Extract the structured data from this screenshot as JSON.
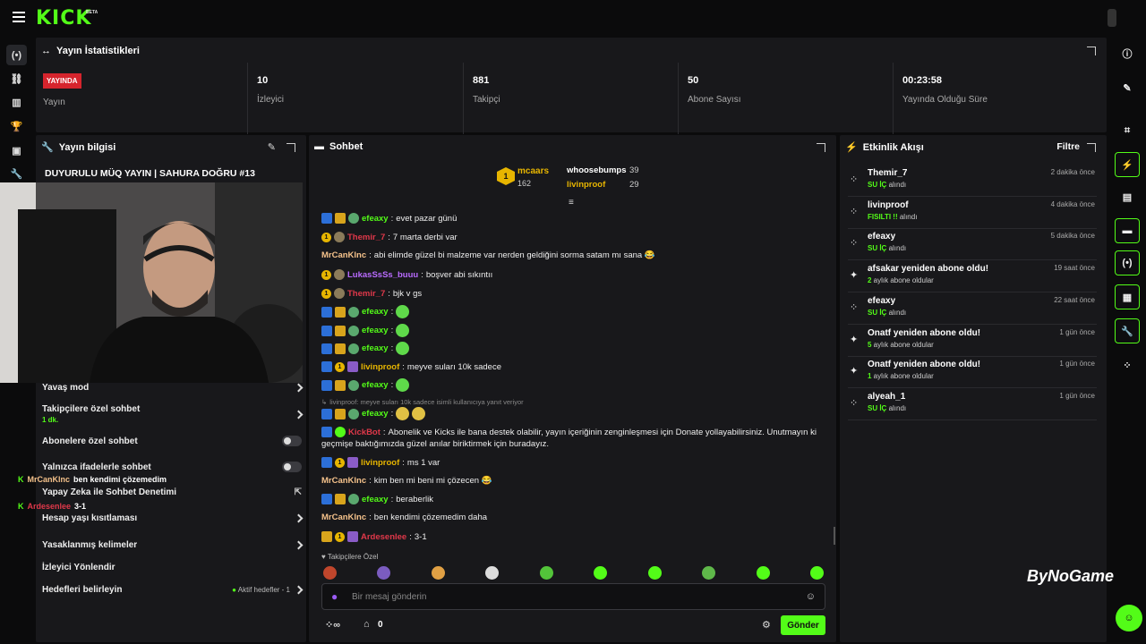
{
  "brand": {
    "logo": "KICK",
    "beta": "BETA",
    "color": "#53fc18"
  },
  "stats": {
    "title": "Yayın İstatistikleri",
    "live_badge": "YAYINDA",
    "items": [
      {
        "value": "",
        "label": "Yayın"
      },
      {
        "value": "10",
        "label": "İzleyici"
      },
      {
        "value": "881",
        "label": "Takipçi"
      },
      {
        "value": "50",
        "label": "Abone Sayısı"
      },
      {
        "value": "00:23:58",
        "label": "Yayında Olduğu Süre"
      }
    ]
  },
  "stream_info": {
    "title": "Yayın bilgisi",
    "stream_title": "DUYURULU MÜQ YAYIN | SAHURA DOĞRU #13",
    "settings": [
      {
        "label": "Yavaş mod",
        "control": "chevron"
      },
      {
        "label": "Takipçilere özel sohbet",
        "sub": "1 dk.",
        "control": "chevron"
      },
      {
        "label": "Abonelere özel sohbet",
        "control": "toggle"
      },
      {
        "label": "Yalnızca ifadelerle sohbet",
        "control": "toggle"
      },
      {
        "label": "Yapay Zeka ile Sohbet Denetimi",
        "control": "external"
      },
      {
        "label": "Hesap yaşı kısıtlaması",
        "control": "chevron"
      },
      {
        "label": "Yasaklanmış kelimeler",
        "control": "chevron"
      },
      {
        "label": "İzleyici Yönlendir",
        "control": "none"
      },
      {
        "label": "Hedefleri belirleyin",
        "extra": "Aktif hedefler - 1",
        "control": "chevron"
      }
    ],
    "overlay_chat": [
      {
        "user": "MrCanKlnc",
        "text": "ben kendimi çözemedim"
      },
      {
        "user": "Ardesenlee",
        "text": "3-1"
      }
    ]
  },
  "chat": {
    "title": "Sohbet",
    "leaderboard": {
      "top_name": "mcaars",
      "top_count": "162",
      "rank": "1",
      "second_name": "whoosebumps",
      "second_count": "39",
      "third_name": "livinproof",
      "third_count": "29"
    },
    "messages": [
      {
        "user": "efeaxy",
        "color": "#53fc18",
        "text": "evet pazar günü"
      },
      {
        "user": "Themir_7",
        "color": "#e0384a",
        "text": "7 marta derbi var"
      },
      {
        "user": "MrCanKlnc",
        "color": "#f5c28b",
        "text": "abi elimde güzel bi malzeme var nerden geldiğini sorma satam mı sana 😂"
      },
      {
        "user": "LukasSsSs_buuu",
        "color": "#b96bff",
        "text": "boşver abi sıkıntıı"
      },
      {
        "user": "Themir_7",
        "color": "#e0384a",
        "text": "bjk v gs"
      },
      {
        "user": "efeaxy",
        "color": "#53fc18",
        "text": ""
      },
      {
        "user": "efeaxy",
        "color": "#53fc18",
        "text": ""
      },
      {
        "user": "efeaxy",
        "color": "#53fc18",
        "text": ""
      },
      {
        "user": "livinproof",
        "color": "#e7b500",
        "text": "meyve suları 10k sadece"
      },
      {
        "user": "efeaxy",
        "color": "#53fc18",
        "text": ""
      },
      {
        "user": "efeaxy",
        "color": "#53fc18",
        "text": ""
      },
      {
        "user": "KickBot",
        "color": "#e0384a",
        "text": "Abonelik ve Kicks ile bana destek olabilir, yayın içeriğinin zenginleşmesi için Donate yollayabilirsiniz. Unutmayın ki"
      },
      {
        "user": "livinproof",
        "color": "#e7b500",
        "text": "ms 1 var"
      },
      {
        "user": "MrCanKlnc",
        "color": "#f5c28b",
        "text": "kim ben mi beni mi çözecen 😂"
      },
      {
        "user": "efeaxy",
        "color": "#53fc18",
        "text": "beraberlik"
      },
      {
        "user": "MrCanKlnc",
        "color": "#f5c28b",
        "text": "ben kendimi çözemedim daha"
      },
      {
        "user": "Ardesenlee",
        "color": "#e0384a",
        "text": "3-1"
      }
    ],
    "kickbot_line2": "geçmişe baktığımızda güzel anılar biriktirmek için buradayız.",
    "reply_note": "livinproof: meyve suları 10k sadece isimli kullanıcıya yanıt veriyor",
    "followers_only": "Takipçilere Özel",
    "input_placeholder": "Bir mesaj gönderin",
    "send": "Gönder",
    "kicks_count": "0"
  },
  "activity": {
    "title": "Etkinlik Akışı",
    "filter": "Filtre",
    "events": [
      {
        "name": "Themir_7",
        "hl": "SU İÇ",
        "rest": " alındı",
        "time": "2 dakika önce",
        "icon": "gift"
      },
      {
        "name": "livinproof",
        "hl": "FISILTI !!",
        "rest": " alındı",
        "time": "4 dakika önce",
        "icon": "gift"
      },
      {
        "name": "efeaxy",
        "hl": "SU İÇ",
        "rest": " alındı",
        "time": "5 dakika önce",
        "icon": "gift"
      },
      {
        "name": "afsakar yeniden abone oldu!",
        "hl": "2",
        "rest": " aylık abone oldular",
        "time": "19 saat önce",
        "icon": "star"
      },
      {
        "name": "efeaxy",
        "hl": "SU İÇ",
        "rest": " alındı",
        "time": "22 saat önce",
        "icon": "gift"
      },
      {
        "name": "Onatf yeniden abone oldu!",
        "hl": "5",
        "rest": " aylık abone oldular",
        "time": "1 gün önce",
        "icon": "star"
      },
      {
        "name": "Onatf yeniden abone oldu!",
        "hl": "1",
        "rest": " aylık abone oldular",
        "time": "1 gün önce",
        "icon": "star"
      },
      {
        "name": "alyeah_1",
        "hl": "SU İÇ",
        "rest": " alındı",
        "time": "1 gün önce",
        "icon": "gift"
      }
    ]
  },
  "watermark": "ByNoGame"
}
